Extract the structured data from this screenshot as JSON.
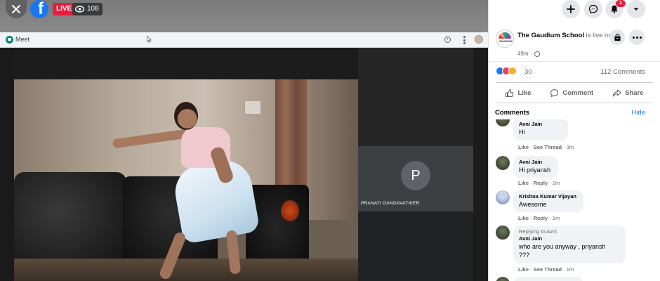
{
  "overlay": {
    "live_label": "LIVE",
    "viewer_count": "108"
  },
  "meet": {
    "app_label": "Meet"
  },
  "participant": {
    "initial": "P",
    "name": "PRANATI GANGAVATIKER"
  },
  "header_actions": {
    "notification_count": "1"
  },
  "post": {
    "page_name": "The Gaudium School",
    "status_text": "is live now.",
    "logo_text": "GAUDIUM",
    "time": "49m",
    "reaction_count": "30",
    "comment_count": "112 Comments",
    "actions": {
      "like": "Like",
      "comment": "Comment",
      "share": "Share"
    }
  },
  "comments_section": {
    "title": "Comments",
    "hide_label": "Hide",
    "items": [
      {
        "name": "Avni Jain",
        "text": "Hi",
        "reply_to": "",
        "like": "Like",
        "action": "See Thread",
        "time": "3m"
      },
      {
        "name": "Avni Jain",
        "text": "Hi priyansh",
        "reply_to": "",
        "like": "Like",
        "action": "Reply",
        "time": "2m"
      },
      {
        "name": "Krishna Kumar Vijayan",
        "text": "Awesome",
        "reply_to": "",
        "like": "Like",
        "action": "Reply",
        "time": "1m"
      },
      {
        "name": "Avni Jain",
        "text_line1": "who are you anyway , priyansh",
        "text_line2": "???",
        "reply_to": "Replying to Avni",
        "like": "Like",
        "action": "See Thread",
        "time": "1m"
      }
    ]
  },
  "colors": {
    "facebook_blue": "#1877f2",
    "live_red": "#e41e3f",
    "panel_bg": "#ffffff",
    "bubble_bg": "#f0f2f5"
  }
}
